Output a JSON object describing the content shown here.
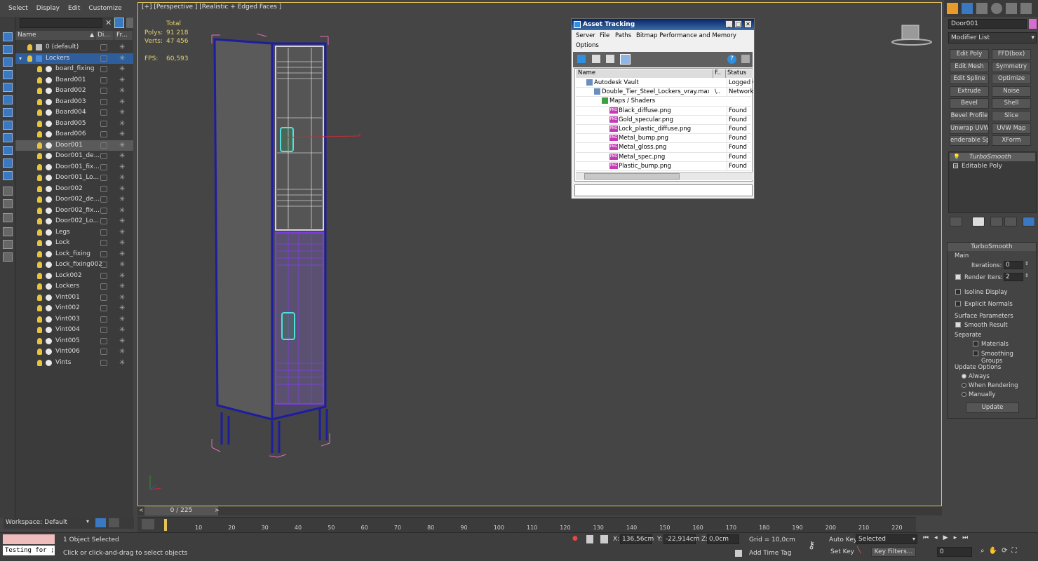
{
  "menu": {
    "items": [
      "Select",
      "Display",
      "Edit",
      "Customize"
    ]
  },
  "scene_explorer": {
    "columns": [
      "Name",
      "Di...",
      "Fr..."
    ],
    "rows": [
      {
        "label": "0 (default)",
        "type": "layer"
      },
      {
        "label": "Lockers",
        "type": "layer",
        "selected": true
      },
      {
        "label": "board_fixing"
      },
      {
        "label": "Board001"
      },
      {
        "label": "Board002"
      },
      {
        "label": "Board003"
      },
      {
        "label": "Board004"
      },
      {
        "label": "Board005"
      },
      {
        "label": "Board006"
      },
      {
        "label": "Door001",
        "highlighted": true
      },
      {
        "label": "Door001_de..."
      },
      {
        "label": "Door001_fix..."
      },
      {
        "label": "Door001_Lo..."
      },
      {
        "label": "Door002"
      },
      {
        "label": "Door002_de..."
      },
      {
        "label": "Door002_fix..."
      },
      {
        "label": "Door002_Lo..."
      },
      {
        "label": "Legs"
      },
      {
        "label": "Lock"
      },
      {
        "label": "Lock_fixing"
      },
      {
        "label": "Lock_fixing002"
      },
      {
        "label": "Lock002"
      },
      {
        "label": "Lockers"
      },
      {
        "label": "Vint001"
      },
      {
        "label": "Vint002"
      },
      {
        "label": "Vint003"
      },
      {
        "label": "Vint004"
      },
      {
        "label": "Vint005"
      },
      {
        "label": "Vint006"
      },
      {
        "label": "Vints"
      }
    ],
    "workspace": "Workspace: Default"
  },
  "viewport": {
    "label": "[+] [Perspective ] [Realistic + Edged Faces ]",
    "stats": {
      "total_label": "Total",
      "polys_label": "Polys:",
      "polys": "91 218",
      "verts_label": "Verts:",
      "verts": "47 456",
      "fps_label": "FPS:",
      "fps": "60,593"
    },
    "axis_x": "x"
  },
  "asset_tracking": {
    "title": "Asset Tracking",
    "menu": [
      "Server",
      "File",
      "Paths",
      "Bitmap Performance and Memory",
      "Options"
    ],
    "columns": [
      "Name",
      "F..",
      "Status"
    ],
    "rows": [
      {
        "name": "Autodesk Vault",
        "f": "",
        "status": "Logged O",
        "indent": 1
      },
      {
        "name": "Double_Tier_Steel_Lockers_vray.max",
        "f": "\\..",
        "status": "Network",
        "indent": 2
      },
      {
        "name": "Maps / Shaders",
        "f": "",
        "status": "",
        "indent": 3
      },
      {
        "name": "Black_diffuse.png",
        "f": "",
        "status": "Found",
        "indent": 4,
        "png": true
      },
      {
        "name": "Gold_specular.png",
        "f": "",
        "status": "Found",
        "indent": 4,
        "png": true
      },
      {
        "name": "Lock_plastic_diffuse.png",
        "f": "",
        "status": "Found",
        "indent": 4,
        "png": true
      },
      {
        "name": "Metal_bump.png",
        "f": "",
        "status": "Found",
        "indent": 4,
        "png": true
      },
      {
        "name": "Metal_gloss.png",
        "f": "",
        "status": "Found",
        "indent": 4,
        "png": true
      },
      {
        "name": "Metal_spec.png",
        "f": "",
        "status": "Found",
        "indent": 4,
        "png": true
      },
      {
        "name": "Plastic_bump.png",
        "f": "",
        "status": "Found",
        "indent": 4,
        "png": true
      }
    ],
    "png_tag": "PNG"
  },
  "command_panel": {
    "object_name": "Door001",
    "modifier_list": "Modifier List",
    "modifier_buttons": [
      "Edit Poly",
      "FFD(box)",
      "Edit Mesh",
      "Symmetry",
      "Edit Spline",
      "Optimize",
      "Extrude",
      "Noise",
      "Bevel",
      "Shell",
      "Bevel Profile",
      "Slice",
      "Unwrap UVW",
      "UVW Map",
      "enderable Splin",
      "XForm"
    ],
    "stack": [
      "TurboSmooth",
      "Editable Poly"
    ],
    "rollout_title": "TurboSmooth",
    "main_label": "Main",
    "iterations_label": "Iterations:",
    "iterations": "0",
    "render_iters_label": "Render Iters:",
    "render_iters": "2",
    "isoline_label": "Isoline Display",
    "explicit_normals_label": "Explicit Normals",
    "surface_params_label": "Surface Parameters",
    "smooth_result_label": "Smooth Result",
    "separate_label": "Separate",
    "materials_label": "Materials",
    "smoothing_groups_label": "Smoothing Groups",
    "update_options_label": "Update Options",
    "always_label": "Always",
    "when_rendering_label": "When Rendering",
    "manually_label": "Manually",
    "update_button": "Update"
  },
  "timeline": {
    "frame": "0 / 225",
    "ticks": [
      "10",
      "20",
      "30",
      "40",
      "50",
      "60",
      "70",
      "80",
      "90",
      "100",
      "110",
      "120",
      "130",
      "140",
      "150",
      "160",
      "170",
      "180",
      "190",
      "200",
      "210",
      "220"
    ]
  },
  "status": {
    "script_text": "Testing for ;",
    "selection": "1 Object Selected",
    "prompt": "Click or click-and-drag to select objects",
    "x_label": "X:",
    "x": "136,56cm",
    "y_label": "Y:",
    "y": "-22,914cm",
    "z_label": "Z:",
    "z": "0,0cm",
    "grid": "Grid = 10,0cm",
    "add_time_tag": "Add Time Tag",
    "auto_key": "Auto Key",
    "set_key": "Set Key",
    "selected_dropdown": "Selected",
    "key_filters": "Key Filters...",
    "frame_field": "0"
  }
}
